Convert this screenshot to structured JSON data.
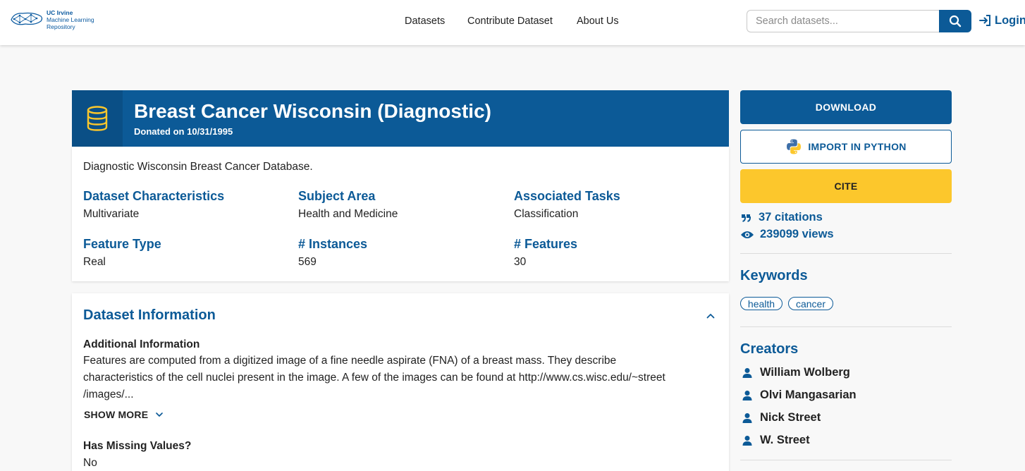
{
  "header": {
    "logo": {
      "line1": "UC Irvine",
      "line2": "Machine Learning",
      "line3": "Repository"
    },
    "nav": [
      {
        "label": "Datasets"
      },
      {
        "label": "Contribute Dataset"
      },
      {
        "label": "About Us"
      }
    ],
    "search_placeholder": "Search datasets...",
    "login_label": "Login"
  },
  "dataset": {
    "title": "Breast Cancer Wisconsin (Diagnostic)",
    "donated": "Donated on 10/31/1995",
    "description": "Diagnostic Wisconsin Breast Cancer Database.",
    "characteristics": [
      {
        "label": "Dataset Characteristics",
        "value": "Multivariate"
      },
      {
        "label": "Subject Area",
        "value": "Health and Medicine"
      },
      {
        "label": "Associated Tasks",
        "value": "Classification"
      },
      {
        "label": "Feature Type",
        "value": "Real"
      },
      {
        "label": "# Instances",
        "value": "569"
      },
      {
        "label": "# Features",
        "value": "30"
      }
    ]
  },
  "info": {
    "title": "Dataset Information",
    "additional_heading": "Additional Information",
    "additional_lines": [
      "Features are computed from a digitized image of a fine needle aspirate (FNA) of a breast mass.  They describe",
      "characteristics of the cell nuclei present in the image. A few of the images can be found at http://www.cs.wisc.edu/~street",
      "/images/..."
    ],
    "show_more": "SHOW MORE",
    "missing_heading": "Has Missing Values?",
    "missing_value": "No"
  },
  "sidebar": {
    "download": "DOWNLOAD",
    "import_python": "IMPORT IN PYTHON",
    "cite": "CITE",
    "citations": "37 citations",
    "views": "239099 views",
    "keywords_title": "Keywords",
    "keywords": [
      "health",
      "cancer"
    ],
    "creators_title": "Creators",
    "creators": [
      "William Wolberg",
      "Olvi Mangasarian",
      "Nick Street",
      "W. Street"
    ]
  },
  "colors": {
    "primary": "#0c5a97",
    "accent": "#fcc72c",
    "background": "#f8f8f8"
  },
  "icons": {
    "hero": "database-icon",
    "search": "search-icon",
    "login": "login-icon",
    "python": "python-icon",
    "citations": "quote-icon",
    "views": "eye-icon",
    "creator": "person-icon",
    "collapse": "chevron-up-icon",
    "show_more": "chevron-down-icon"
  }
}
